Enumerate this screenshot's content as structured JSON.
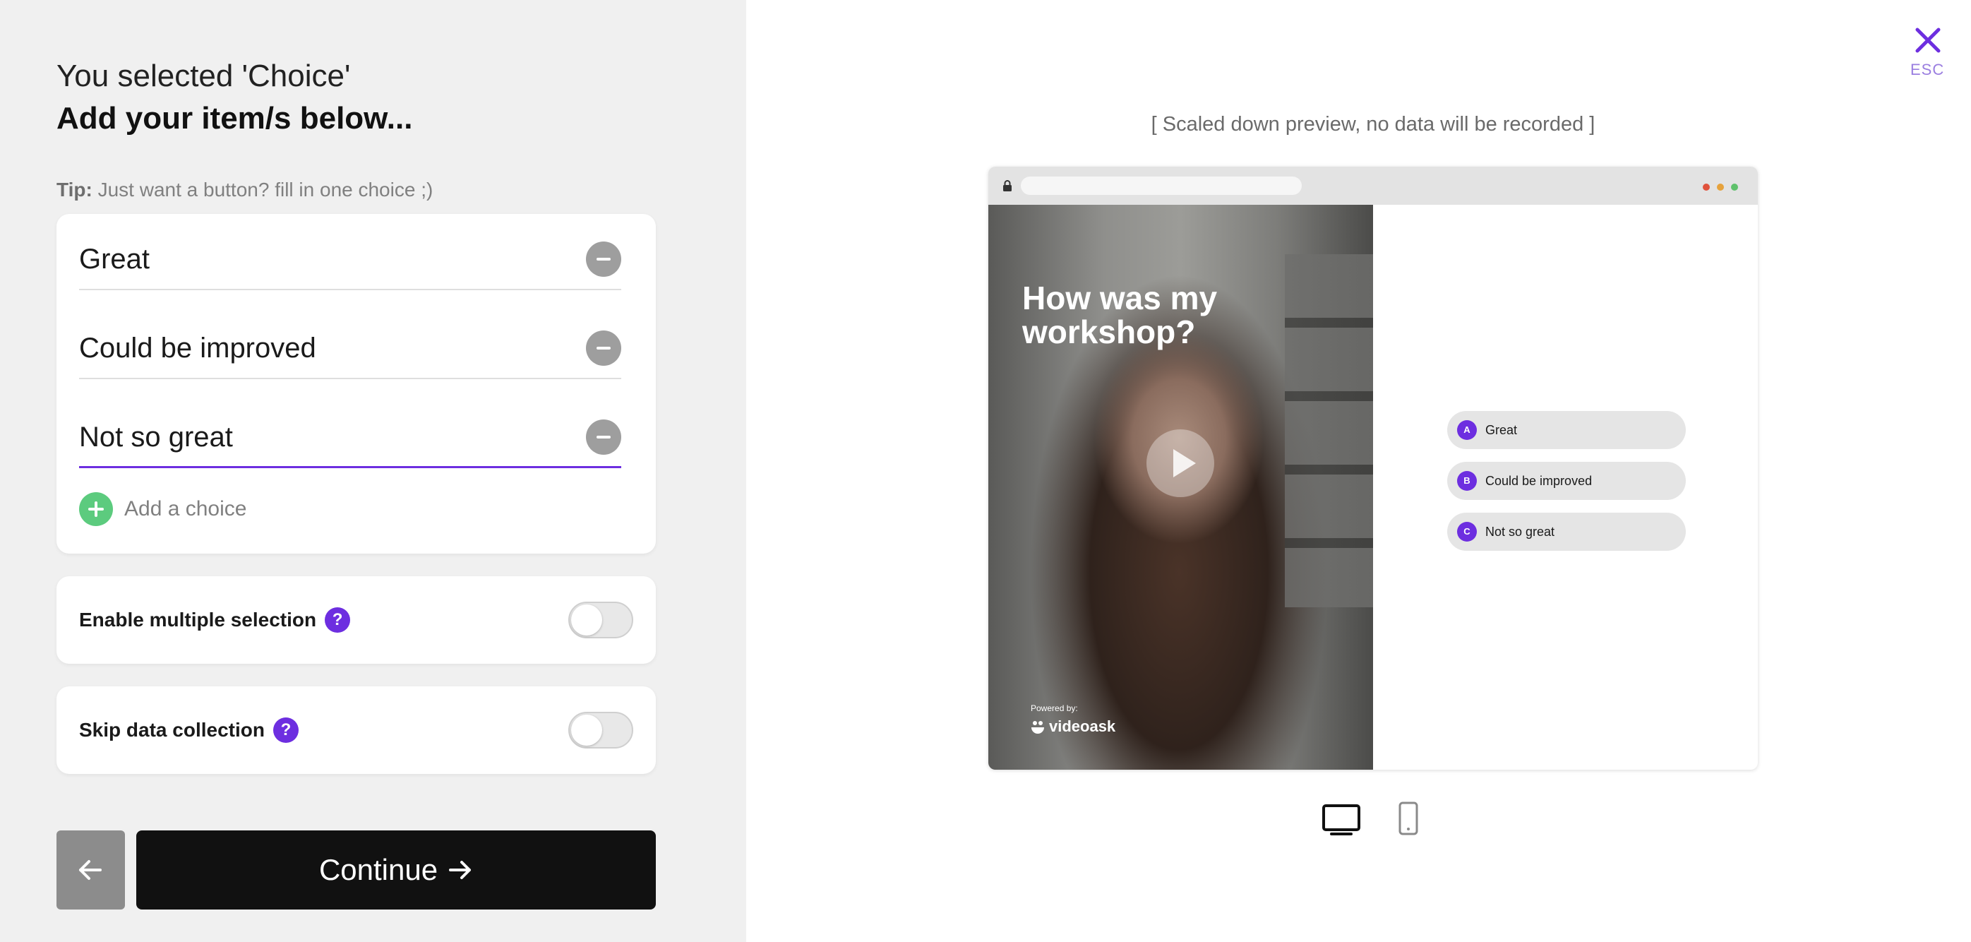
{
  "header": {
    "line1": "You selected 'Choice'",
    "line2": "Add your item/s below..."
  },
  "tip": {
    "prefix": "Tip:",
    "text": " Just want a button? fill in one choice ;)"
  },
  "choices": [
    {
      "label": "Great"
    },
    {
      "label": "Could be improved"
    },
    {
      "label": "Not so great"
    }
  ],
  "add_choice_label": "Add a choice",
  "options": {
    "multiple": {
      "label": "Enable multiple selection",
      "help": "?",
      "enabled": false
    },
    "skip": {
      "label": "Skip data collection",
      "help": "?",
      "enabled": false
    }
  },
  "footer": {
    "continue_label": "Continue"
  },
  "close": {
    "esc_label": "ESC"
  },
  "preview": {
    "note": "[ Scaled down preview, no data will be recorded ]",
    "video_title": "How was my workshop?",
    "powered_by": "Powered by:",
    "brand": "videoask",
    "choices": [
      {
        "letter": "A",
        "label": "Great"
      },
      {
        "letter": "B",
        "label": "Could be improved"
      },
      {
        "letter": "C",
        "label": "Not so great"
      }
    ],
    "window_dots": [
      "#e0533d",
      "#e6a23c",
      "#5fc16c"
    ]
  },
  "device_toggle": {
    "selected": "desktop-icon"
  },
  "colors": {
    "accent": "#6d2ee0",
    "add": "#5ccb7e",
    "primary_button": "#111111",
    "left_panel_bg": "#f0f0f0"
  }
}
